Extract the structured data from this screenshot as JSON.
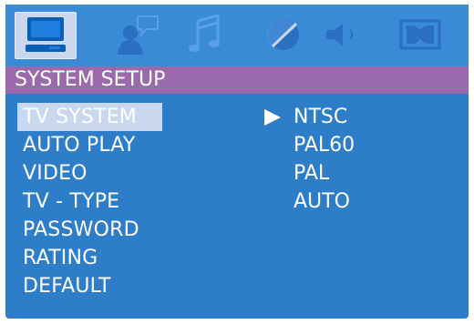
{
  "header": {
    "title": "SYSTEM SETUP",
    "icons": [
      "system-icon",
      "language-icon",
      "audio-icon",
      "video-icon",
      "speaker-icon",
      "dolby-icon"
    ],
    "active_icon": "system-icon"
  },
  "menu": {
    "items": [
      {
        "label": "TV SYSTEM",
        "selected": true
      },
      {
        "label": "AUTO PLAY"
      },
      {
        "label": "VIDEO"
      },
      {
        "label": "TV - TYPE"
      },
      {
        "label": "PASSWORD"
      },
      {
        "label": "RATING"
      },
      {
        "label": "DEFAULT"
      }
    ]
  },
  "options": {
    "items": [
      {
        "label": "NTSC",
        "current": true
      },
      {
        "label": "PAL60"
      },
      {
        "label": "PAL"
      },
      {
        "label": "AUTO"
      }
    ]
  },
  "colors": {
    "background": "#2e7dc8",
    "title_bar": "#9b6aac",
    "highlight": "#c9d8ef",
    "text": "#ffffff"
  }
}
